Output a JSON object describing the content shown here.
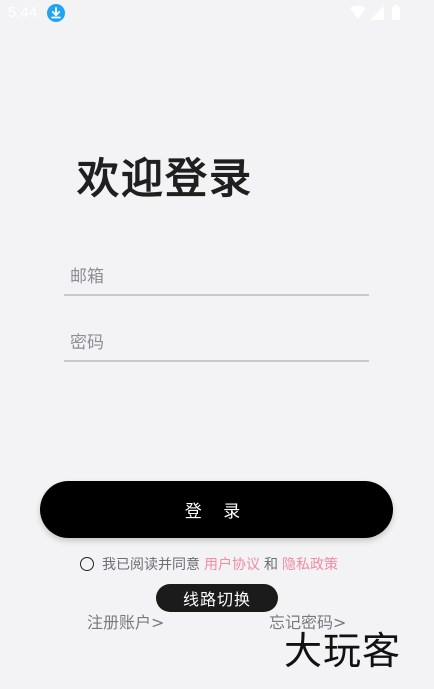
{
  "status": {
    "time": "5:44"
  },
  "title": "欢迎登录",
  "form": {
    "email_placeholder": "邮箱",
    "password_placeholder": "密码"
  },
  "login_button": "登 录",
  "agreement": {
    "prefix": "我已阅读并同意",
    "user_agreement": "用户协议",
    "and": "和",
    "privacy_policy": "隐私政策"
  },
  "links": {
    "register": "注册账户>",
    "forgot": "忘记密码>"
  },
  "route_switch": "线路切换",
  "watermark": "大玩客",
  "colors": {
    "accent_pink": "#f08ca3",
    "download_blue": "#22a3f0"
  }
}
